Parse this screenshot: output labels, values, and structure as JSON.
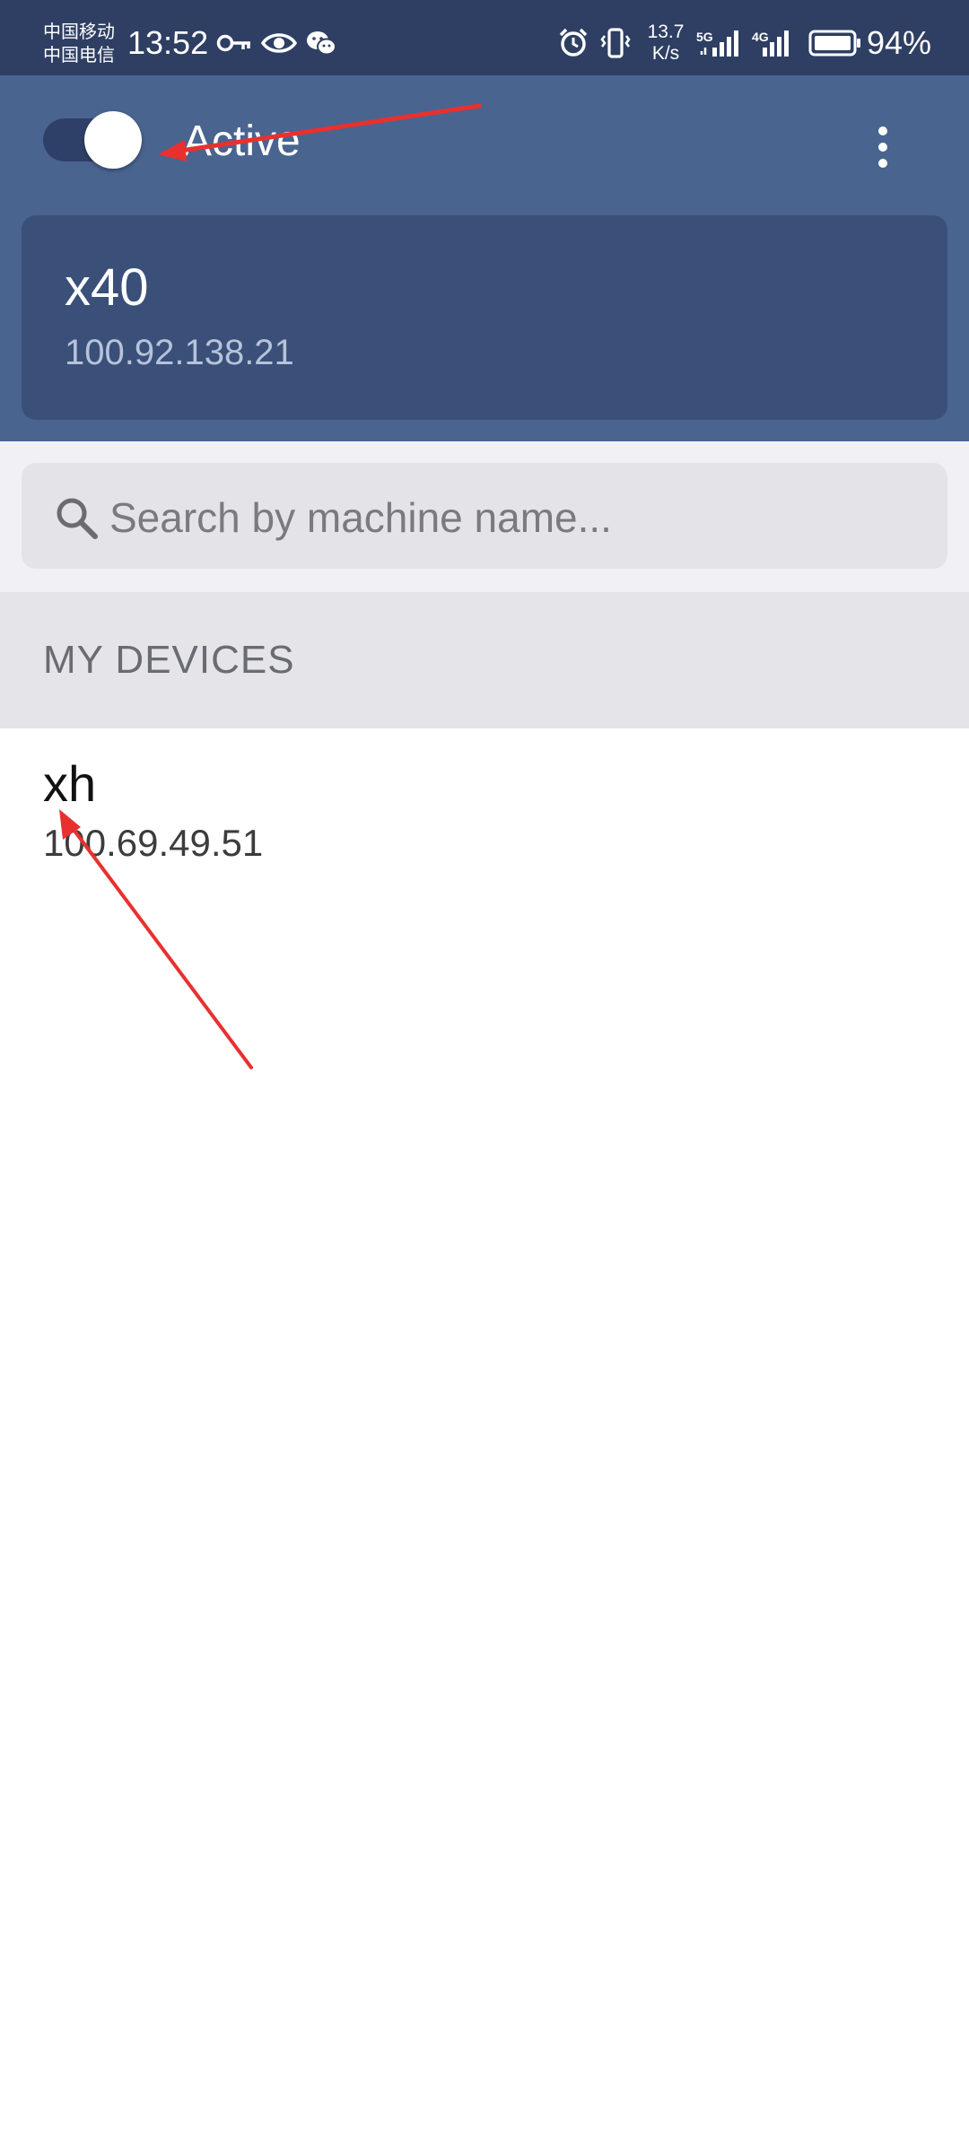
{
  "status_bar": {
    "carrier_1": "中国移动",
    "carrier_2": "中国电信",
    "time": "13:52",
    "net_speed_value": "13.7",
    "net_speed_unit": "K/s",
    "signal_1_type": "5G",
    "signal_2_type": "4G",
    "battery_percent": "94%",
    "icons": [
      "key-icon",
      "eye-icon",
      "wechat-icon",
      "alarm-icon",
      "vibrate-icon",
      "signal-icon",
      "battery-icon"
    ]
  },
  "header": {
    "toggle_on": true,
    "status_label": "Active",
    "menu_icon": "more-vertical-icon"
  },
  "current_device": {
    "name": "x40",
    "ip": "100.92.138.21"
  },
  "search": {
    "placeholder": "Search by machine name...",
    "value": ""
  },
  "devices_section": {
    "title": "MY DEVICES",
    "items": [
      {
        "name": "xh",
        "ip": "100.69.49.51"
      }
    ]
  },
  "colors": {
    "status_bar": "#2e3f63",
    "header": "#4a6490",
    "card": "#3a5079",
    "annotation_arrow": "#e8312f"
  }
}
